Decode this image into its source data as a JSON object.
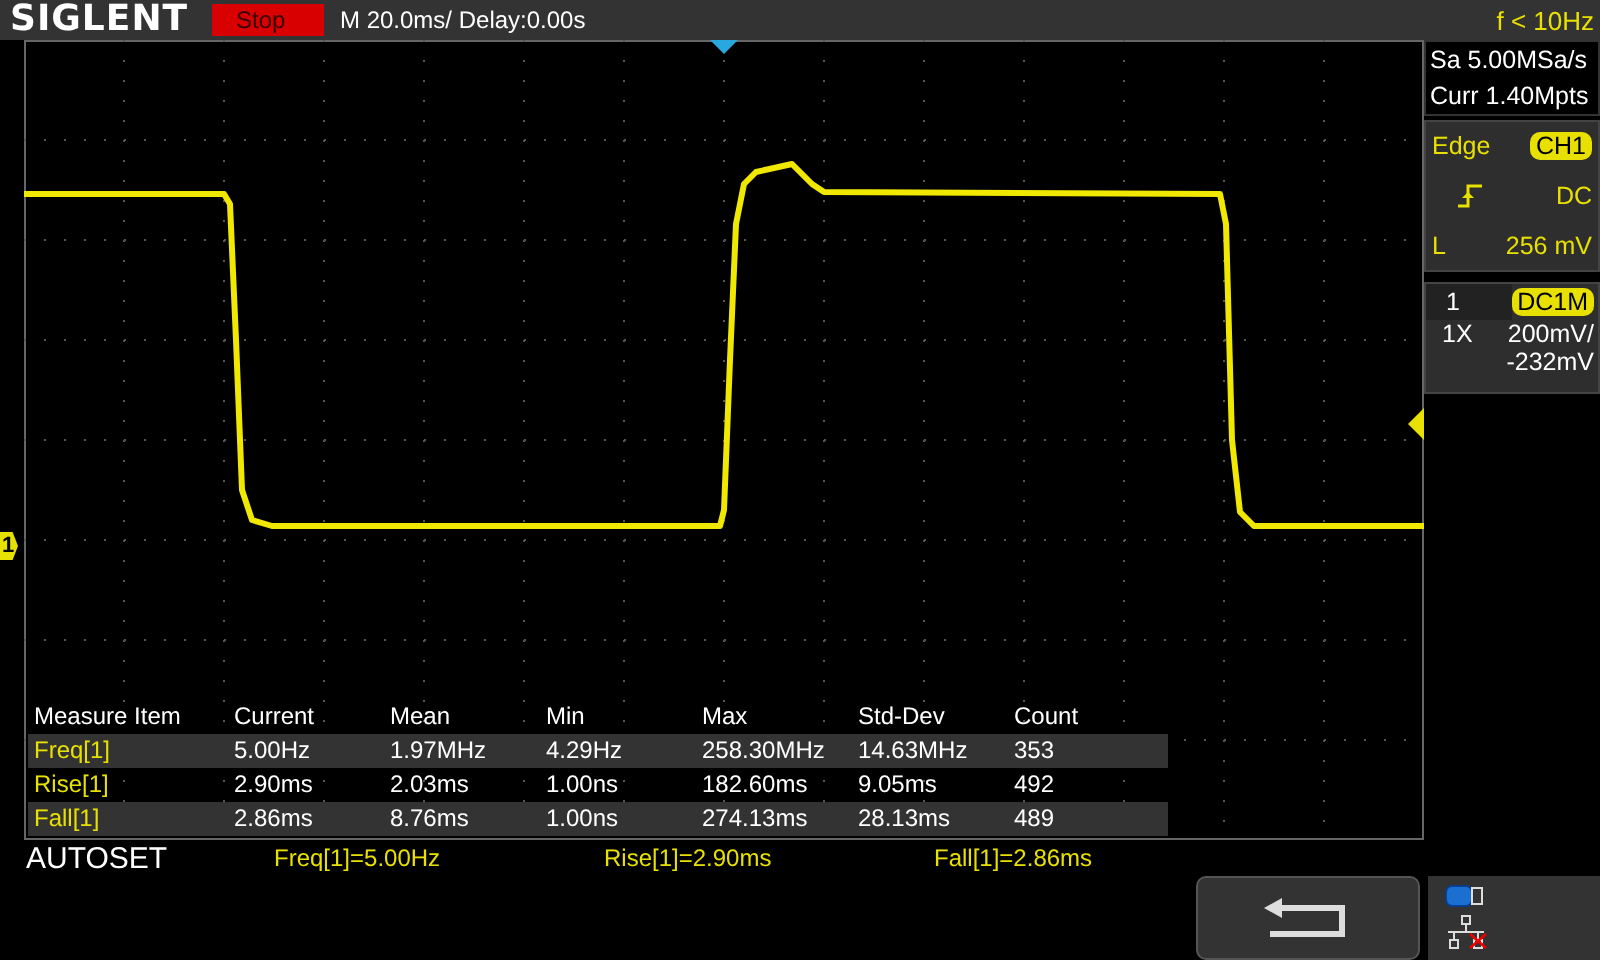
{
  "header": {
    "brand": "SIGLENT",
    "run_state": "Stop",
    "timebase": "M 20.0ms/ Delay:0.00s",
    "trigger_frequency": "f < 10Hz"
  },
  "acquisition": {
    "sample_rate": "Sa 5.00MSa/s",
    "memory_depth": "Curr 1.40Mpts"
  },
  "trigger": {
    "type": "Edge",
    "source": "CH1",
    "coupling": "DC",
    "level_label": "L",
    "level_value": "256 mV"
  },
  "channel": {
    "number": "1",
    "coupling": "DC1M",
    "probe": "1X",
    "scale": "200mV/",
    "offset": "-232mV"
  },
  "markers": {
    "channel_label": "1"
  },
  "measurements": {
    "columns": [
      "Measure Item",
      "Current",
      "Mean",
      "Min",
      "Max",
      "Std-Dev",
      "Count"
    ],
    "rows": [
      {
        "cells": [
          "Freq[1]",
          "5.00Hz",
          "1.97MHz",
          "4.29Hz",
          "258.30MHz",
          "14.63MHz",
          "353"
        ]
      },
      {
        "cells": [
          "Rise[1]",
          "2.90ms",
          "2.03ms",
          "1.00ns",
          "182.60ms",
          "9.05ms",
          "492"
        ]
      },
      {
        "cells": [
          "Fall[1]",
          "2.86ms",
          "8.76ms",
          "1.00ns",
          "274.13ms",
          "28.13ms",
          "489"
        ]
      }
    ]
  },
  "footer": {
    "autoset": "AUTOSET",
    "readouts": [
      "Freq[1]=5.00Hz",
      "Rise[1]=2.90ms",
      "Fall[1]=2.86ms"
    ]
  }
}
